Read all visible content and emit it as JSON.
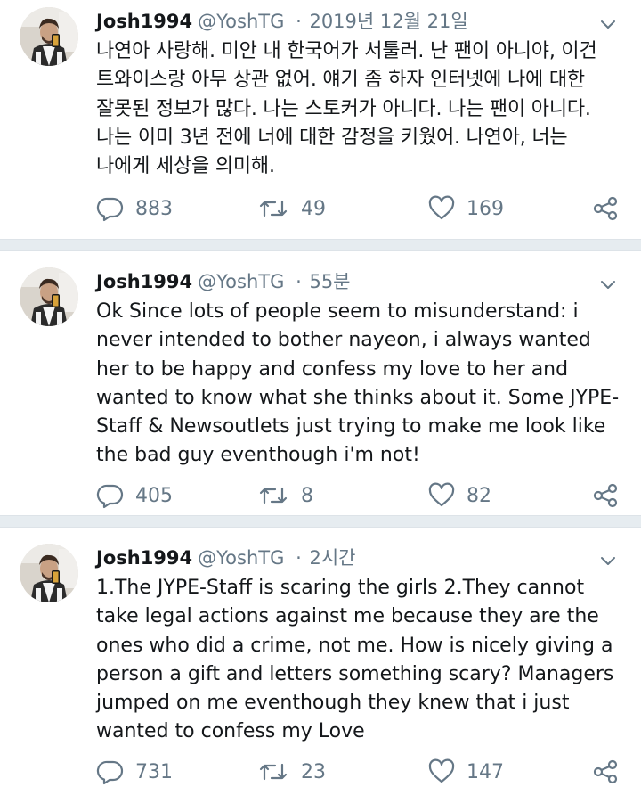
{
  "tweets": [
    {
      "name": "Josh1994",
      "handle": "@YoshTG",
      "dot": "·",
      "time": "2019년 12월 21일",
      "text": "나연아 사랑해. 미안 내 한국어가 서툴러. 난 팬이 아니야, 이건 트와이스랑 아무 상관 없어. 얘기 좀 하자 인터넷에 나에 대한 잘못된 정보가 많다. 나는 스토커가 아니다. 나는 팬이 아니다. 나는 이미 3년 전에 너에 대한 감정을 키웠어. 나연아, 너는 나에게 세상을 의미해.",
      "replies": "883",
      "retweets": "49",
      "likes": "169"
    },
    {
      "name": "Josh1994",
      "handle": "@YoshTG",
      "dot": "·",
      "time": "55분",
      "text": "Ok Since lots of people seem to misunderstand: i never intended to bother nayeon, i always wanted her to be happy and confess my love to her and wanted to know what she thinks about it. Some JYPE-Staff & Newsoutlets just trying to make me look like the bad guy eventhough i'm not!",
      "replies": "405",
      "retweets": "8",
      "likes": "82"
    },
    {
      "name": "Josh1994",
      "handle": "@YoshTG",
      "dot": "·",
      "time": "2시간",
      "text": "1.The JYPE-Staff is scaring the girls 2.They cannot take legal actions against me because they are the ones who did a crime, not me. How is nicely giving a person a gift and letters something scary? Managers jumped on me eventhough they knew that i just wanted to confess my Love",
      "replies": "731",
      "retweets": "23",
      "likes": "147"
    }
  ],
  "icons": {
    "reply": "reply-icon",
    "retweet": "retweet-icon",
    "like": "heart-icon",
    "share": "share-icon",
    "menu": "chevron-down-icon"
  },
  "colors": {
    "text": "#14171a",
    "secondary": "#657786",
    "separator": "#e6ecf0"
  }
}
